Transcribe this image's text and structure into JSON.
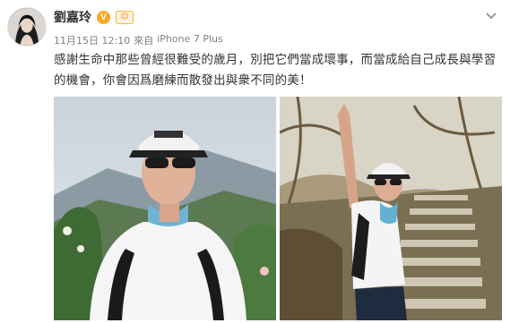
{
  "post": {
    "username": "劉嘉玲",
    "verified_badge": "V",
    "level_badge": "☺",
    "timestamp": "11月15日 12:10",
    "source_prefix": "來自",
    "source_device": "iPhone 7 Plus",
    "content": "感謝生命中那些曾經很難受的歲月，別把它們當成壞事，而當成給自己成長與學習的機會，你會因爲磨練而散發出與衆不同的美！",
    "images": [
      {
        "name": "hiking-selfie",
        "alt": "Woman in white cap and sunglasses on mountain"
      },
      {
        "name": "stairs-raised-arm",
        "alt": "Woman raising arm on forest stairs"
      }
    ]
  },
  "icons": {
    "verified": "verified-v-icon",
    "level": "vip-level-icon",
    "menu": "chevron-down-icon"
  },
  "colors": {
    "verified": "#f9a825",
    "meta": "#808080",
    "text": "#333333"
  }
}
